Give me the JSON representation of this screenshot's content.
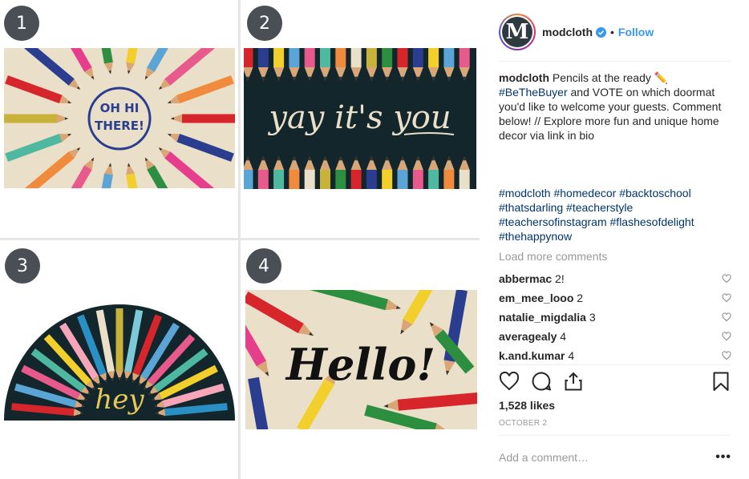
{
  "grid": {
    "badges": [
      "1",
      "2",
      "3",
      "4"
    ],
    "mat_1_text": "OH HI\nTHERE!",
    "mat_1_line1": "OH HI",
    "mat_1_line2": "THERE!",
    "mat_2_text": "yay it's you",
    "mat_3_text": "hey",
    "mat_4_text": "Hello!"
  },
  "post": {
    "username": "modcloth",
    "avatar_letter": "M",
    "follow_label": "Follow",
    "separator": "•",
    "caption_user": "modcloth",
    "caption_text_1": "Pencils at the ready ✏️",
    "caption_hashtag": "#BeTheBuyer",
    "caption_text_2": "and VOTE on which doormat you'd like to welcome your guests. Comment below! // Explore more fun and unique home decor via link in bio",
    "tags": "#modcloth #homedecor #backtoschool #thatsdarling #teacherstyle #teachersofinstagram #flashesofdelight #thehappynow",
    "load_more": "Load more comments",
    "comments": [
      {
        "user": "abbermac",
        "text": "2!"
      },
      {
        "user": "em_mee_looo",
        "text": "2"
      },
      {
        "user": "natalie_migdalia",
        "text": "3"
      },
      {
        "user": "averagealy",
        "text": "4"
      },
      {
        "user": "k.and.kumar",
        "text": "4"
      }
    ],
    "likes": "1,528 likes",
    "date": "OCTOBER 2",
    "add_comment_placeholder": "Add a comment…",
    "more_icon": "•••"
  },
  "colors": {
    "link_blue": "#3897f0",
    "hashtag_blue": "#003569",
    "mat_dark": "#12262b",
    "mat_beige": "#eadfc8"
  },
  "icons": [
    "verified-icon",
    "heart-icon",
    "comment-icon",
    "share-icon",
    "bookmark-icon",
    "heart-small-icon",
    "more-icon"
  ]
}
